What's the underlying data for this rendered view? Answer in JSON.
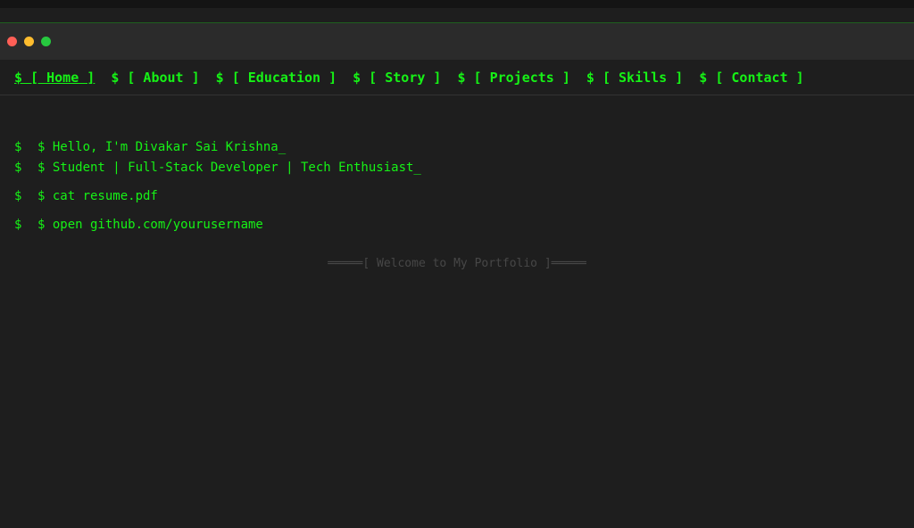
{
  "nav": {
    "items": [
      {
        "label": "$ [ Home ]",
        "active": true
      },
      {
        "label": "$ [ About ]",
        "active": false
      },
      {
        "label": "$ [ Education ]",
        "active": false
      },
      {
        "label": "$ [ Story ]",
        "active": false
      },
      {
        "label": "$ [ Projects ]",
        "active": false
      },
      {
        "label": "$ [ Skills ]",
        "active": false
      },
      {
        "label": "$ [ Contact ]",
        "active": false
      }
    ]
  },
  "terminal": {
    "prompt": "$",
    "lines": [
      "$ Hello, I'm Divakar Sai Krishna_",
      "$ Student | Full-Stack Developer | Tech Enthusiast_",
      "$ cat resume.pdf",
      "$ open github.com/yourusername"
    ]
  },
  "welcome": "═════[ Welcome to My Portfolio ]═════",
  "colors": {
    "background": "#1e1e1e",
    "terminal_green": "#16f216",
    "titlebar": "#2b2b2b",
    "close": "#ff5f56",
    "minimize": "#ffbd2e",
    "maximize": "#27c93f"
  }
}
